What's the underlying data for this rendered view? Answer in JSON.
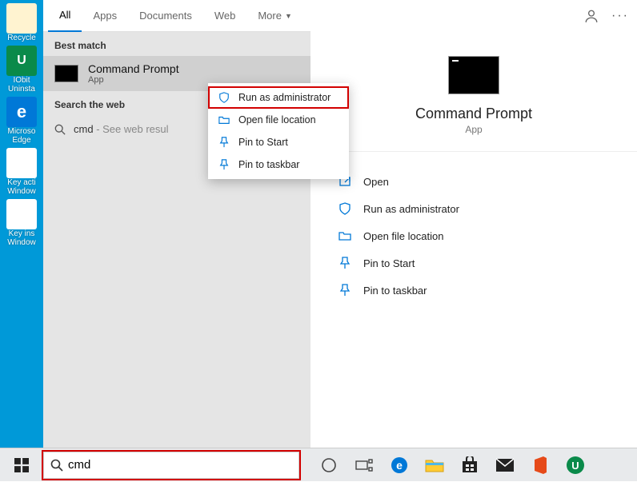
{
  "desktop_icons": [
    {
      "label": "Recycle",
      "color": "#f5f5dc"
    },
    {
      "label": "IObit Uninsta",
      "color": "#0a8a4a"
    },
    {
      "label": "Microso Edge",
      "color": "#0078d7"
    },
    {
      "label": "Key acti Window",
      "color": "#ffffff"
    },
    {
      "label": "Key ins Window",
      "color": "#ffffff"
    }
  ],
  "tabs": {
    "all": "All",
    "apps": "Apps",
    "documents": "Documents",
    "web": "Web",
    "more": "More"
  },
  "sections": {
    "best_match": "Best match",
    "search_web": "Search the web"
  },
  "best_match": {
    "title": "Command Prompt",
    "subtitle": "App"
  },
  "web_search": {
    "query": "cmd",
    "hint": "- See web resul"
  },
  "context_menu": {
    "run_admin": "Run as administrator",
    "open_loc": "Open file location",
    "pin_start": "Pin to Start",
    "pin_taskbar": "Pin to taskbar"
  },
  "detail": {
    "title": "Command Prompt",
    "subtitle": "App",
    "actions": {
      "open": "Open",
      "run_admin": "Run as administrator",
      "open_loc": "Open file location",
      "pin_start": "Pin to Start",
      "pin_taskbar": "Pin to taskbar"
    }
  },
  "search_input": "cmd"
}
